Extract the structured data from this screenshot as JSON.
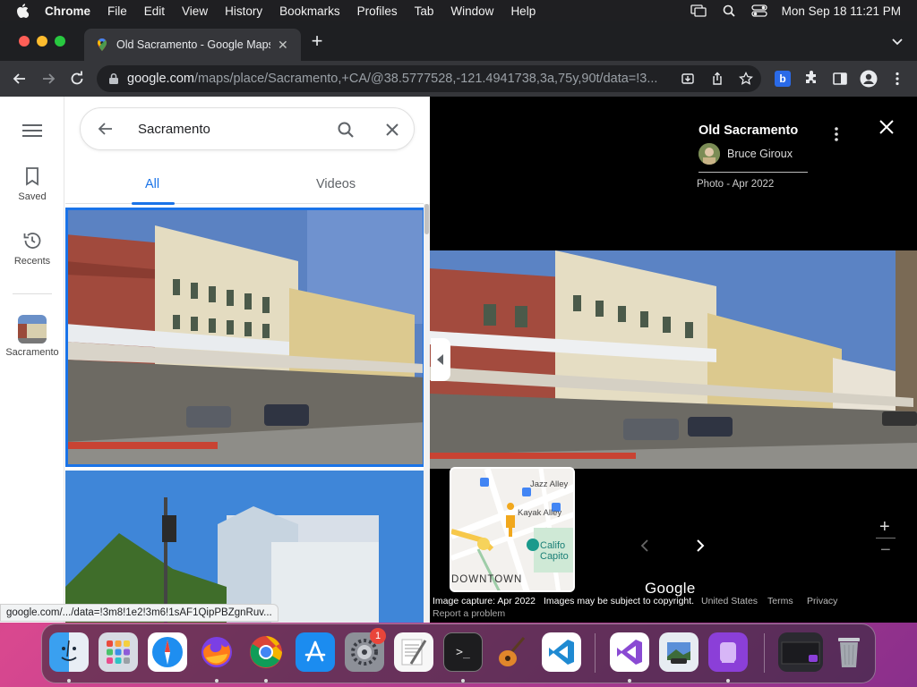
{
  "menubar": {
    "app_name": "Chrome",
    "items": [
      "File",
      "Edit",
      "View",
      "History",
      "Bookmarks",
      "Profiles",
      "Tab",
      "Window",
      "Help"
    ],
    "clock": "Mon Sep 18  11:21 PM",
    "status_icons": [
      "display-icon",
      "spotlight-search-icon",
      "control-center-icon"
    ]
  },
  "browser": {
    "tab_title": "Old Sacramento - Google Maps",
    "url_host": "google.com",
    "url_path": "/maps/place/Sacramento,+CA/@38.5777528,-121.4941738,3a,75y,90t/data=!3...",
    "status_url": "google.com/.../data=!3m8!1e2!3m6!1sAF1QipPBZgnRuv..."
  },
  "rail": {
    "saved_label": "Saved",
    "recents_label": "Recents",
    "place_label": "Sacramento"
  },
  "panel": {
    "search_query": "Sacramento",
    "tab_all": "All",
    "tab_videos": "Videos"
  },
  "viewer": {
    "title": "Old Sacramento",
    "author": "Bruce Giroux",
    "photo_date": "Photo - Apr 2022",
    "minimap": {
      "street_1": "Jazz Alley",
      "street_2": "Kayak Alley",
      "place_line1": "Califo",
      "place_line2": "Capito",
      "district": "DOWNTOWN"
    },
    "zoom_in": "+",
    "zoom_out": "−",
    "google_logo": "Google",
    "image_capture": "Image capture: Apr 2022",
    "copyright": "Images may be subject to copyright.",
    "country": "United States",
    "terms": "Terms",
    "privacy": "Privacy",
    "report": "Report a problem"
  },
  "dock": {
    "apps": [
      "Finder",
      "Launchpad",
      "Safari",
      "Firefox",
      "Chrome",
      "App Store",
      "System Settings",
      "TextEdit",
      "Terminal",
      "GarageBand",
      "Visual Studio Code",
      "Visual Studio",
      "Preview",
      "Podcasts"
    ],
    "settings_badge": "1"
  },
  "colors": {
    "accent": "#1a73e8",
    "menubar": "#1f1f22",
    "toolbar": "#35363a"
  }
}
